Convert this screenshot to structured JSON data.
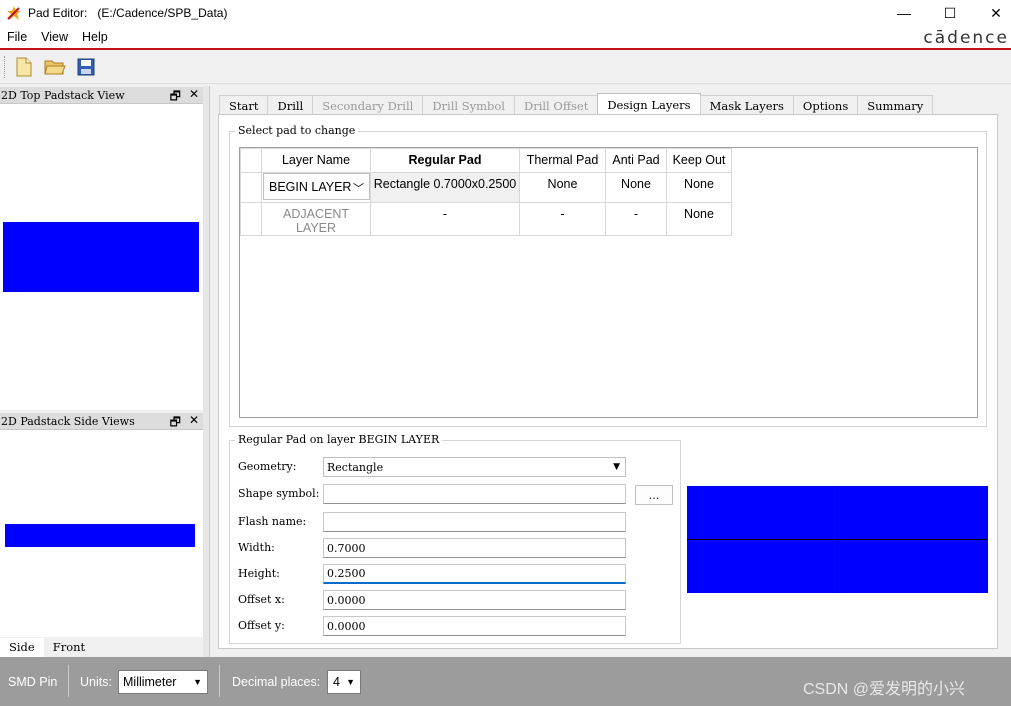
{
  "window": {
    "title": "Pad Editor:",
    "path": "(E:/Cadence/SPB_Data)",
    "min": "—",
    "max": "☐",
    "close": "✕"
  },
  "menu": {
    "file": "File",
    "view": "View",
    "help": "Help",
    "brand": "cādence"
  },
  "toolbar": {
    "new_icon": "new-file-icon",
    "open_icon": "open-folder-icon",
    "save_icon": "save-disk-icon"
  },
  "left": {
    "top_view_title": "2D Top Padstack View",
    "side_view_title": "2D Padstack Side Views",
    "float_icon": "🗗",
    "close_icon": "✕",
    "side_tabs": [
      "Side",
      "Front"
    ]
  },
  "tabs": [
    "Start",
    "Drill",
    "Secondary Drill",
    "Drill Symbol",
    "Drill Offset",
    "Design Layers",
    "Mask Layers",
    "Options",
    "Summary"
  ],
  "select_pad": {
    "group_title": "Select pad to change",
    "headers": [
      "Layer Name",
      "Regular Pad",
      "Thermal Pad",
      "Anti Pad",
      "Keep Out"
    ],
    "rows": [
      {
        "layer": "BEGIN LAYER",
        "regular": "Rectangle 0.7000x0.2500",
        "thermal": "None",
        "anti": "None",
        "keep": "None"
      },
      {
        "layer": "ADJACENT LAYER",
        "regular": "-",
        "thermal": "-",
        "anti": "-",
        "keep": "None"
      }
    ]
  },
  "regular_pad": {
    "group_title": "Regular Pad on layer BEGIN LAYER",
    "geometry_label": "Geometry:",
    "geometry_value": "Rectangle",
    "shape_label": "Shape symbol:",
    "shape_value": "",
    "browse": "...",
    "flash_label": "Flash name:",
    "flash_value": "",
    "width_label": "Width:",
    "width_value": "0.7000",
    "height_label": "Height:",
    "height_value": "0.2500",
    "offx_label": "Offset x:",
    "offx_value": "0.0000",
    "offy_label": "Offset y:",
    "offy_value": "0.0000"
  },
  "status": {
    "mode": "SMD Pin",
    "units_label": "Units:",
    "units_value": "Millimeter",
    "decimal_label": "Decimal places:",
    "decimal_value": "4",
    "watermark": "CSDN @爱发明的小兴"
  },
  "colors": {
    "pad": "#0000ff",
    "accent": "#c4121a",
    "statusbar": "#9c9c9c"
  }
}
